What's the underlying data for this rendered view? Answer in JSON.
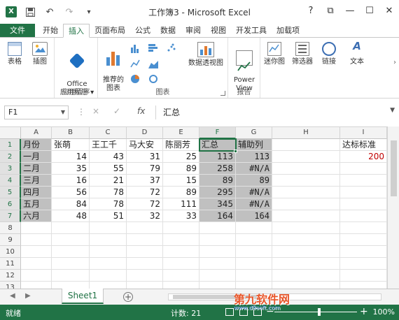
{
  "window": {
    "title": "工作簿3 - Microsoft Excel",
    "app_logo": "X",
    "controls": [
      "?",
      "⧉",
      "—",
      "☐",
      "✕"
    ]
  },
  "quick_access": [
    "save-icon",
    "undo-icon",
    "redo-icon",
    "customize-icon"
  ],
  "ribbon_tabs": [
    "文件",
    "开始",
    "插入",
    "页面布局",
    "公式",
    "数据",
    "审阅",
    "视图",
    "开发工具",
    "加载项"
  ],
  "active_tab": "插入",
  "ribbon": {
    "table_label": "表格",
    "illustration_label": "插图",
    "office_apps_label": "Office\n应用程序 ▾",
    "apps_group": "应用程序",
    "recommended_charts": "推荐的\n图表",
    "charts_group": "图表",
    "pivot_chart": "数据透视图",
    "power_view": "Power\nView",
    "reports_group": "报告",
    "sparklines": "迷你图",
    "filter": "筛选器",
    "link": "链接",
    "text": "文本"
  },
  "formula_bar": {
    "name_box": "F1",
    "cancel": "×",
    "enter": "✓",
    "fx": "fx",
    "value": "汇总"
  },
  "columns": [
    "A",
    "B",
    "C",
    "D",
    "E",
    "F",
    "G",
    "H",
    "I"
  ],
  "rows": [
    "1",
    "2",
    "3",
    "4",
    "5",
    "6",
    "7",
    "8",
    "9",
    "10",
    "11",
    "12",
    "13"
  ],
  "cells": {
    "r1": [
      "月份",
      "张萌",
      "王工千",
      "马大安",
      "陈丽芳",
      "汇总",
      "辅助列",
      "",
      "达标标准"
    ],
    "r2": [
      "一月",
      "14",
      "43",
      "31",
      "25",
      "113",
      "113",
      "",
      "200"
    ],
    "r3": [
      "二月",
      "35",
      "55",
      "79",
      "89",
      "258",
      "#N/A",
      "",
      ""
    ],
    "r4": [
      "三月",
      "16",
      "21",
      "37",
      "15",
      "89",
      "89",
      "",
      ""
    ],
    "r5": [
      "四月",
      "56",
      "78",
      "72",
      "89",
      "295",
      "#N/A",
      "",
      ""
    ],
    "r6": [
      "五月",
      "84",
      "78",
      "72",
      "111",
      "345",
      "#N/A",
      "",
      ""
    ],
    "r7": [
      "六月",
      "48",
      "51",
      "32",
      "33",
      "164",
      "164",
      "",
      ""
    ]
  },
  "sheet": {
    "tab": "Sheet1",
    "add": "+"
  },
  "status": {
    "ready": "就绪",
    "count": "计数: 21",
    "zoom_minus": "−",
    "zoom_plus": "+",
    "zoom": "100%"
  },
  "watermark": {
    "line1": "第九软件网",
    "line2": "www.d9soft.com"
  },
  "colors": {
    "accent": "#217346",
    "selection_fill": "#c0c0c0",
    "standard_value": "#c00000"
  }
}
